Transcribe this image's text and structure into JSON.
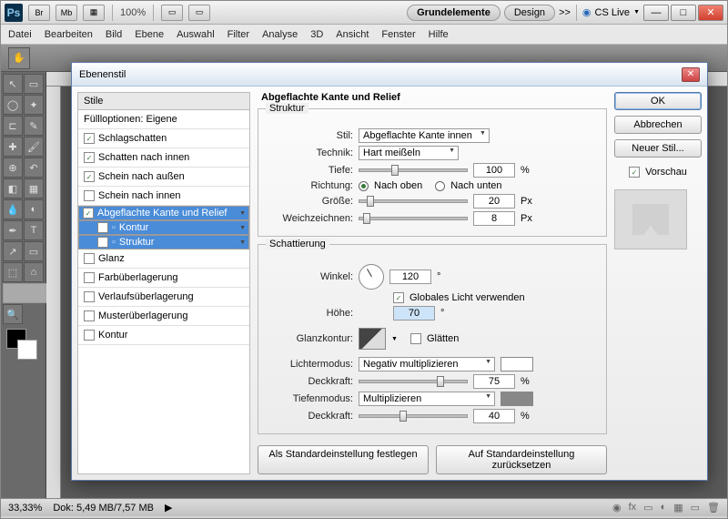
{
  "app": {
    "icon": "Ps",
    "br": "Br",
    "mb": "Mb",
    "zoom": "100%",
    "cs": "CS Live"
  },
  "tabs": {
    "grund": "Grundelemente",
    "design": "Design",
    "more": ">>"
  },
  "menu": [
    "Datei",
    "Bearbeiten",
    "Bild",
    "Ebene",
    "Auswahl",
    "Filter",
    "Analyse",
    "3D",
    "Ansicht",
    "Fenster",
    "Hilfe"
  ],
  "status": {
    "zoom": "33,33%",
    "doc": "Dok: 5,49 MB/7,57 MB"
  },
  "dialog": {
    "title": "Ebenenstil",
    "stylesHeader": "Stile",
    "fillOptions": "Füllloptionen: Eigene",
    "items": [
      {
        "label": "Schlagschatten",
        "on": true
      },
      {
        "label": "Schatten nach innen",
        "on": true
      },
      {
        "label": "Schein nach außen",
        "on": true
      },
      {
        "label": "Schein nach innen",
        "on": false
      },
      {
        "label": "Abgeflachte Kante und Relief",
        "on": true,
        "sel": true
      },
      {
        "label": "Kontur",
        "on": false,
        "sub": true,
        "sel": true
      },
      {
        "label": "Struktur",
        "on": false,
        "sub": true,
        "sel": true
      },
      {
        "label": "Glanz",
        "on": false
      },
      {
        "label": "Farbüberlagerung",
        "on": false
      },
      {
        "label": "Verlaufsüberlagerung",
        "on": false
      },
      {
        "label": "Musterüberlagerung",
        "on": false
      },
      {
        "label": "Kontur",
        "on": false
      }
    ],
    "panelTitle": "Abgeflachte Kante und Relief",
    "struktur": {
      "legend": "Struktur",
      "stil": {
        "lbl": "Stil:",
        "val": "Abgeflachte Kante innen"
      },
      "technik": {
        "lbl": "Technik:",
        "val": "Hart meißeln"
      },
      "tiefe": {
        "lbl": "Tiefe:",
        "val": "100",
        "unit": "%"
      },
      "richtung": {
        "lbl": "Richtung:",
        "up": "Nach oben",
        "down": "Nach unten"
      },
      "groesse": {
        "lbl": "Größe:",
        "val": "20",
        "unit": "Px"
      },
      "weich": {
        "lbl": "Weichzeichnen:",
        "val": "8",
        "unit": "Px"
      }
    },
    "schatt": {
      "legend": "Schattierung",
      "winkel": {
        "lbl": "Winkel:",
        "val": "120",
        "unit": "°"
      },
      "global": "Globales Licht verwenden",
      "hoehe": {
        "lbl": "Höhe:",
        "val": "70",
        "unit": "°"
      },
      "glanz": {
        "lbl": "Glanzkontur:"
      },
      "glaetten": "Glätten",
      "lichter": {
        "lbl": "Lichtermodus:",
        "val": "Negativ multiplizieren"
      },
      "deck1": {
        "lbl": "Deckkraft:",
        "val": "75",
        "unit": "%"
      },
      "tiefen": {
        "lbl": "Tiefenmodus:",
        "val": "Multiplizieren"
      },
      "deck2": {
        "lbl": "Deckkraft:",
        "val": "40",
        "unit": "%"
      }
    },
    "btns": {
      "default": "Als Standardeinstellung festlegen",
      "reset": "Auf Standardeinstellung zurücksetzen",
      "ok": "OK",
      "cancel": "Abbrechen",
      "new": "Neuer Stil...",
      "preview": "Vorschau"
    }
  }
}
